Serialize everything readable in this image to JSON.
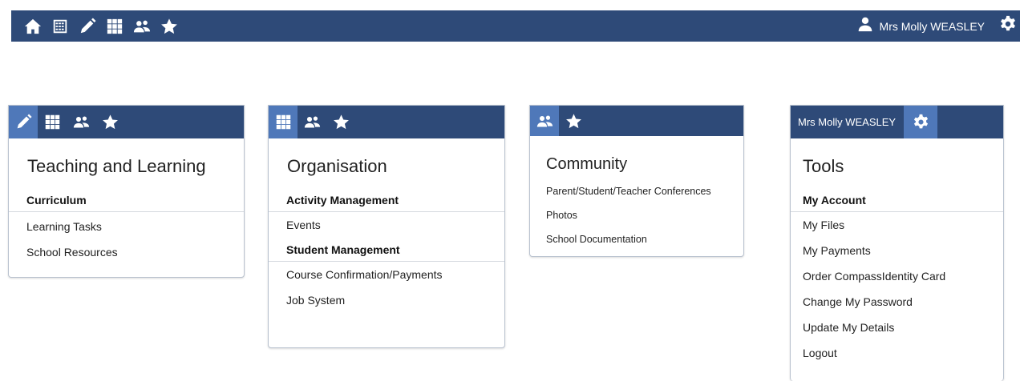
{
  "topbar": {
    "icons": [
      "home-icon",
      "calendar-icon",
      "pencil-icon",
      "grid-icon",
      "people-icon",
      "star-icon"
    ],
    "user_name": "Mrs Molly WEASLEY",
    "accent": "#2e4a78"
  },
  "teaching": {
    "title": "Teaching and Learning",
    "section": "Curriculum",
    "items": [
      "Learning Tasks",
      "School Resources"
    ]
  },
  "organisation": {
    "title": "Organisation",
    "sections": [
      {
        "heading": "Activity Management",
        "items": [
          "Events"
        ]
      },
      {
        "heading": "Student Management",
        "items": [
          "Course Confirmation/Payments",
          "Job System"
        ]
      }
    ]
  },
  "community": {
    "title": "Community",
    "items": [
      "Parent/Student/Teacher Conferences",
      "Photos",
      "School Documentation"
    ]
  },
  "tools": {
    "user_label": "Mrs Molly WEASLEY",
    "title": "Tools",
    "section": "My Account",
    "items": [
      "My Files",
      "My Payments",
      "Order CompassIdentity Card",
      "Change My Password",
      "Update My Details",
      "Logout"
    ]
  },
  "colors": {
    "header_bg": "#2e4a78",
    "active_tab": "#4f78b9"
  }
}
